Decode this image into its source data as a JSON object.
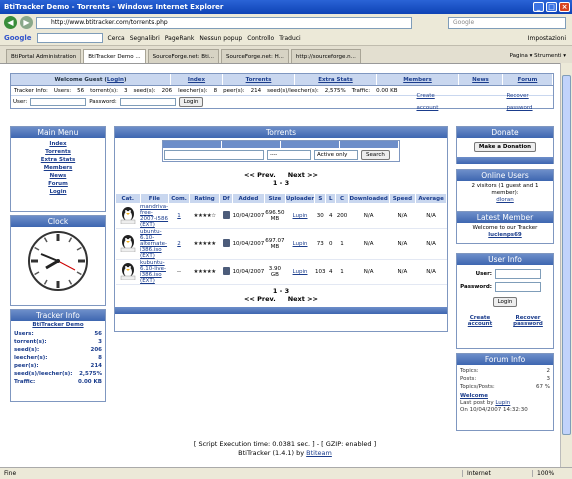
{
  "window": {
    "title": "BtiTracker Demo - Torrents - Windows Internet Explorer"
  },
  "address": {
    "url": "http://www.btitracker.com/torrents.php",
    "search_placeholder": "Google"
  },
  "google_toolbar": {
    "logo": "Google",
    "items": [
      "Cerca",
      "Segnalibri",
      "PageRank",
      "Nessun popup",
      "Controllo",
      "Traduci"
    ],
    "settings": "Impostazioni"
  },
  "tabs": [
    "BtiPortal Administration",
    "BtiTracker Demo ...",
    "SourceForge.net: Bti...",
    "SourceForge.net: H...",
    "http://sourceforge.n..."
  ],
  "tab_tools": "Pagina ▾  Strumenti ▾",
  "nav": {
    "welcome": "Welcome Guest (",
    "login_link": "Login",
    "welcome_close": ")",
    "links": [
      "Index",
      "Torrents",
      "Extra Stats",
      "Members",
      "News",
      "Forum"
    ]
  },
  "stats": {
    "tracker_info": "Tracker Info:",
    "users_label": "Users:",
    "users": "56",
    "torrents_label": "torrent(s):",
    "torrents": "3",
    "seeds_label": "seed(s):",
    "seeds": "206",
    "leechers_label": "leecher(s):",
    "leechers": "8",
    "peers_label": "peer(s):",
    "peers": "214",
    "ratio_label": "seed(s)/leecher(s):",
    "ratio": "2,575%",
    "traffic_label": "Traffic:",
    "traffic": "0.00 KB"
  },
  "loginbar": {
    "user_label": "User:",
    "password_label": "Password:",
    "login_button": "Login",
    "create_account": "Create account",
    "recover_password": "Recover password"
  },
  "main_menu": {
    "title": "Main Menu",
    "items": [
      "Index",
      "Torrents",
      "Extra Stats",
      "Members",
      "News",
      "Forum",
      "Login"
    ]
  },
  "clock": {
    "title": "Clock"
  },
  "tracker_info": {
    "title": "Tracker Info",
    "name": "BtiTracker Demo",
    "rows": [
      {
        "label": "Users:",
        "value": "56"
      },
      {
        "label": "torrent(s):",
        "value": "3"
      },
      {
        "label": "seed(s):",
        "value": "206"
      },
      {
        "label": "leecher(s):",
        "value": "8"
      },
      {
        "label": "peer(s):",
        "value": "214"
      },
      {
        "label": "seed(s)/leecher(s):",
        "value": "2,575%"
      },
      {
        "label": "Traffic:",
        "value": "0.00 KB"
      }
    ]
  },
  "torrents": {
    "title": "Torrents",
    "filter_value": "Active only",
    "category_value": "----",
    "search_button": "Search",
    "prev": "<< Prev.",
    "next": "Next >>",
    "range": "1 - 3",
    "headers": [
      "Cat.",
      "File",
      "Com.",
      "Rating",
      "Df",
      "Added",
      "Size",
      "Uploader",
      "S",
      "L",
      "C",
      "Downloaded",
      "Speed",
      "Average"
    ],
    "rows": [
      {
        "cat": "Linux",
        "file": "mandriva-free-2007-i586 (EXT)",
        "com": "1",
        "rating": "★★★★☆",
        "added": "10/04/2007",
        "size": "696.50 MB",
        "uploader": "Lupin",
        "s": "30",
        "l": "4",
        "c": "200",
        "downloaded": "N/A",
        "speed": "N/A",
        "average": "N/A"
      },
      {
        "cat": "Linux",
        "file": "ubuntu-6.10-alternate-i386.iso (EXT)",
        "com": "2",
        "rating": "★★★★★",
        "added": "10/04/2007",
        "size": "697.07 MB",
        "uploader": "Lupin",
        "s": "73",
        "l": "0",
        "c": "1",
        "downloaded": "N/A",
        "speed": "N/A",
        "average": "N/A"
      },
      {
        "cat": "Linux",
        "file": "kubuntu-6.10-live-i386.iso (EXT)",
        "com": "--",
        "rating": "★★★★★",
        "added": "10/04/2007",
        "size": "3.90 GB",
        "uploader": "Lupin",
        "s": "103",
        "l": "4",
        "c": "1",
        "downloaded": "N/A",
        "speed": "N/A",
        "average": "N/A"
      }
    ]
  },
  "donate": {
    "title": "Donate",
    "button": "Make a Donation"
  },
  "online": {
    "title": "Online Users",
    "text": "2 visitors (1 guest and 1 member):",
    "member": "dloran"
  },
  "latest": {
    "title": "Latest Member",
    "text": "Welcome to our Tracker",
    "member": "lucienps69"
  },
  "user_info": {
    "title": "User Info",
    "user_label": "User:",
    "password_label": "Password:",
    "login_button": "Login",
    "create_account": "Create account",
    "recover_password": "Recover password"
  },
  "forum": {
    "title": "Forum Info",
    "rows": [
      {
        "label": "Topics:",
        "value": "2"
      },
      {
        "label": "Posts:",
        "value": "3"
      },
      {
        "label": "Topics/Posts:",
        "value": "67 %"
      }
    ],
    "welcome": "Welcome",
    "last_post_prefix": "Last post by",
    "last_post_user": "Lupin",
    "last_post_date": "On 10/04/2007 14:32:30"
  },
  "footer": {
    "line1": "[ Script Execution time: 0.0381 sec. ] - [ GZIP: enabled ]",
    "line2_prefix": "BtiTracker (1.4.1) by ",
    "line2_link": "Btiteam"
  },
  "status": {
    "left": "Fine",
    "zone": "Internet",
    "zoom": "100%"
  }
}
